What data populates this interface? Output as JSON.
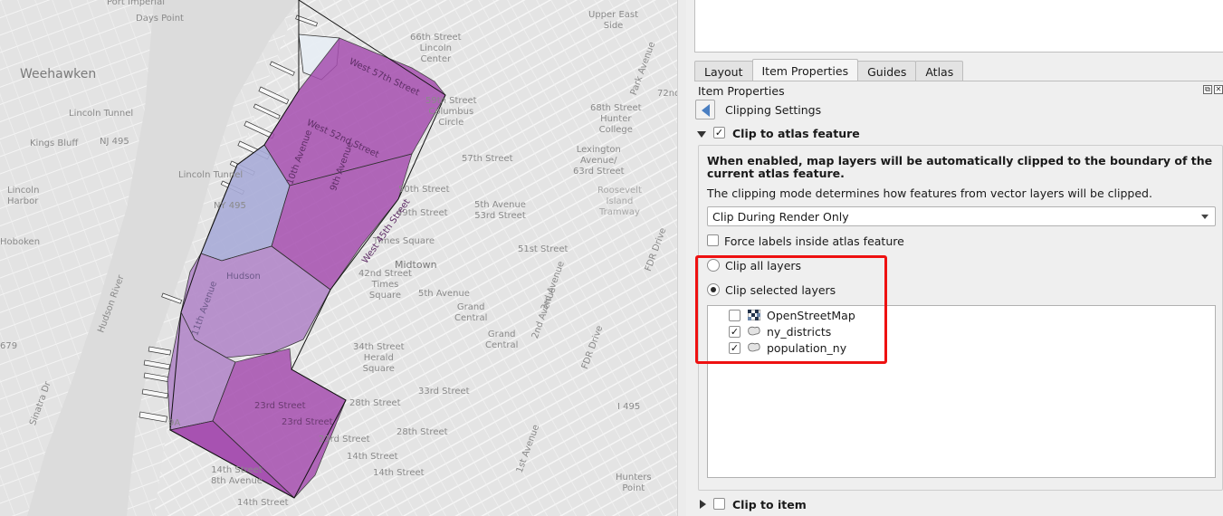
{
  "map": {
    "labels": {
      "port_imperial": "Port Imperial",
      "days_point": "Days Point",
      "weehawken": "Weehawken",
      "lincoln_tunnel": "Lincoln Tunnel",
      "nj495_1": "NJ 495",
      "kings_bluff": "Kings Bluff",
      "lincoln_tunnel_2": "Lincoln Tunnel",
      "lincoln_harbor": "Lincoln\nHarbor",
      "ny495": "NY 495",
      "hudson_river": "Hudson River",
      "upper_east_side": "Upper East\nSide",
      "st_66": "66th Street\nLincoln\nCenter",
      "st_59_circle": "59th Street\nColumbus\nCircle",
      "st_68_hunter": "68th Street\nHunter\nCollege",
      "lexington": "Lexington\nAvenue/\n63rd Street",
      "st_57": "57th Street",
      "st_50": "50th Street",
      "st_49": "49th Street",
      "fifth_53": "5th Avenue\n53rd Street",
      "st_51": "51st Street",
      "times_square": "Times Square",
      "midtown": "Midtown",
      "times_sq_42": "42nd Street\nTimes\nSquare",
      "fifth_ave": "5th Avenue",
      "grand_central": "Grand\nCentral",
      "grand_central_2": "Grand\nCentral",
      "st_34_herald": "34th Street\nHerald\nSquare",
      "st_33": "33rd Street",
      "st_28": "28th Street",
      "st_28_b": "28th Street",
      "st_23": "23rd Street",
      "st_23_b": "23rd Street",
      "st_23_c": "23rd Street",
      "st_14": "14th Street",
      "st_14_b": "14th Street",
      "st_14_ave": "14th Street\n8th Avenue",
      "i495": "I 495",
      "hunters_point": "Hunters\nPoint",
      "fdr_drive": "FDR Drive",
      "fdr_drive_2": "FDR Drive",
      "roosevelt": "Roosevelt\nIsland\nTramway",
      "park_ave": "Park Avenue",
      "first_ave": "1st Avenue",
      "second_ave": "2nd Avenue",
      "third_ave": "3rd Avenue",
      "ave_72": "72nd",
      "num_679": "679",
      "sinatra": "Sinatra Dr",
      "hoboken": "Hoboken",
      "nine_a": "9A",
      "hudson": "Hudson",
      "eleven_ave": "11th Avenue",
      "west_57": "West 57th Street",
      "west_52": "West 52nd Street",
      "west_45": "West 45th Street",
      "tenth_ave": "10th Avenue",
      "ninth_ave": "9th Avenue"
    },
    "colors": {
      "purple": "#a64fb0",
      "lavender": "#a9acd8",
      "light_purple": "#b389c9"
    }
  },
  "panel": {
    "tabs": [
      "Layout",
      "Item Properties",
      "Guides",
      "Atlas"
    ],
    "active_tab": "Item Properties",
    "item_properties_title": "Item Properties",
    "dock_float_icon": "⧉",
    "dock_close_icon": "✕",
    "back_button_icon": "back-arrow-icon",
    "clipping_settings": "Clipping Settings",
    "clip_atlas": {
      "title": "Clip to atlas feature",
      "checked": true,
      "check_glyph": "✓",
      "info_bold": "When enabled, map layers will be automatically clipped to the boundary of the current atlas feature.",
      "info_text": "The clipping mode determines how features from vector layers will be clipped.",
      "mode_value": "Clip During Render Only",
      "force_labels": "Force labels inside atlas feature",
      "force_labels_checked": false,
      "clip_all_layers": "Clip all layers",
      "clip_selected_layers": "Clip selected layers",
      "selected_radio": "Clip selected layers",
      "layers": [
        {
          "name": "OpenStreetMap",
          "checked": false,
          "icon": "raster-layer-icon"
        },
        {
          "name": "ny_districts",
          "checked": true,
          "icon": "polygon-layer-icon"
        },
        {
          "name": "population_ny",
          "checked": true,
          "icon": "polygon-layer-icon"
        }
      ]
    },
    "clip_item": {
      "title": "Clip to item",
      "checked": false
    },
    "highlight_color": "#ee1111"
  }
}
